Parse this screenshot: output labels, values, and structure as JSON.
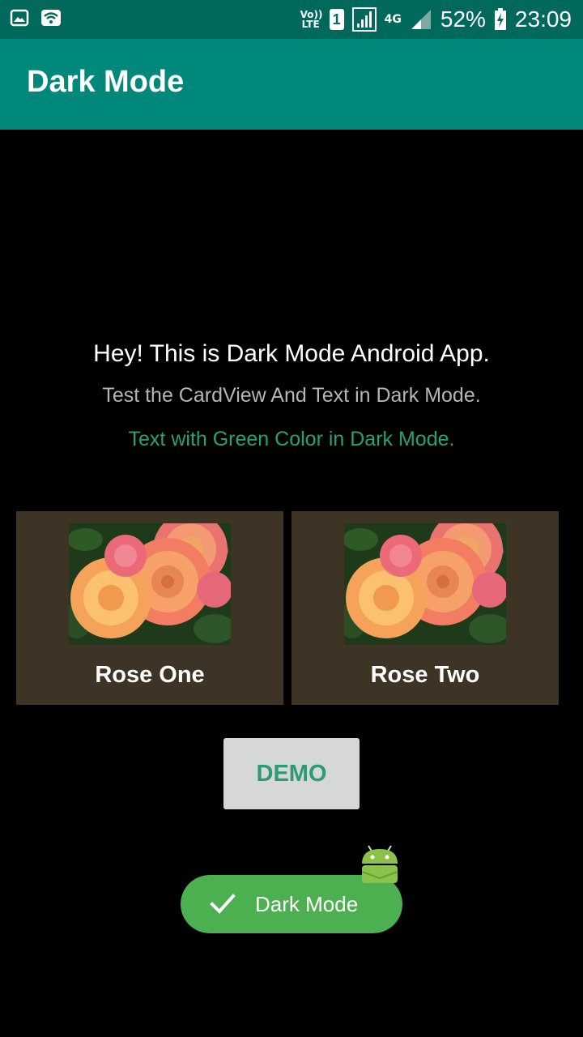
{
  "status_bar": {
    "volte_label": "Vo)) LTE",
    "sim_number": "1",
    "network_type": "4G",
    "battery": "52%",
    "time": "23:09",
    "left_icons": [
      "image-icon",
      "wifi-icon"
    ]
  },
  "app_bar": {
    "title": "Dark Mode",
    "color": "#00897b"
  },
  "content": {
    "heading": "Hey! This is Dark Mode Android App.",
    "subtitle": "Test the CardView And Text in Dark Mode.",
    "green_text": "Text with Green Color in Dark Mode."
  },
  "cards": [
    {
      "title": "Rose One",
      "image": "roses-image"
    },
    {
      "title": "Rose Two",
      "image": "roses-image"
    }
  ],
  "demo_button": {
    "label": "DEMO"
  },
  "toast": {
    "text": "Dark Mode",
    "icon": "check-icon"
  },
  "colors": {
    "background": "#000000",
    "status_bar": "#00695c",
    "card": "#3d3425",
    "green_text": "#26a077",
    "toast": "#4caf50"
  }
}
